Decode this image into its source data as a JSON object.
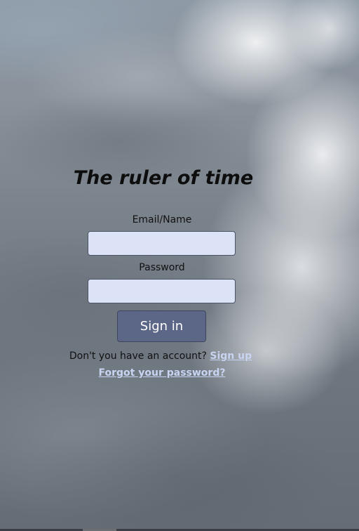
{
  "page": {
    "title": "The ruler of time"
  },
  "form": {
    "email_label": "Email/Name",
    "email_value": "",
    "password_label": "Password",
    "password_value": "",
    "signin_label": "Sign in"
  },
  "footer": {
    "account_prompt": "Don't you have an account?",
    "signup_link": "Sign up",
    "forgot_link": "Forgot your password?"
  },
  "colors": {
    "input_background": "#dde3f6",
    "button_background": "#5c6687",
    "link_color": "#c9d4f2"
  }
}
